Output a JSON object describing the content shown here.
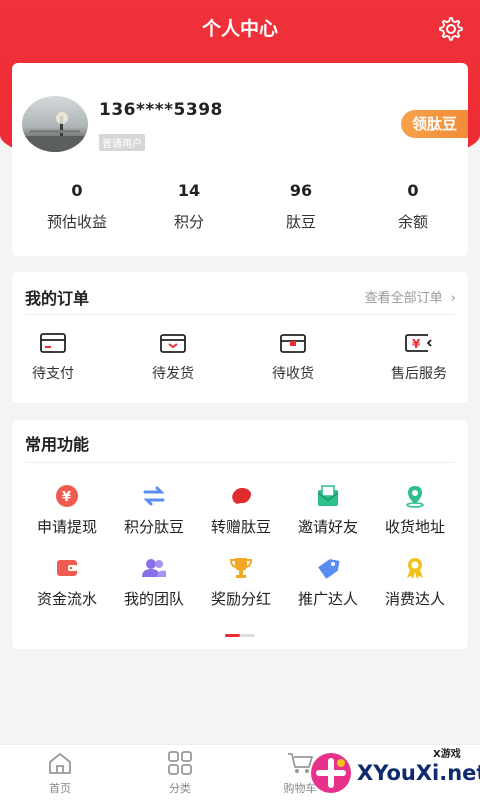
{
  "header": {
    "title": "个人中心"
  },
  "profile": {
    "phone": "136****5398",
    "level": "普通用户",
    "bean_button": "领肽豆",
    "stats": [
      {
        "value": "0",
        "label": "预估收益"
      },
      {
        "value": "14",
        "label": "积分"
      },
      {
        "value": "96",
        "label": "肽豆"
      },
      {
        "value": "0",
        "label": "余额"
      }
    ]
  },
  "orders": {
    "title": "我的订单",
    "view_all": "查看全部订单",
    "items": [
      {
        "label": "待支付",
        "icon": "wallet-icon"
      },
      {
        "label": "待发货",
        "icon": "box-icon"
      },
      {
        "label": "待收货",
        "icon": "package-icon"
      },
      {
        "label": "售后服务",
        "icon": "yen-refund-icon"
      }
    ]
  },
  "functions": {
    "title": "常用功能",
    "items": [
      {
        "label": "申请提现",
        "icon": "yen-coin-icon"
      },
      {
        "label": "积分肽豆",
        "icon": "exchange-icon"
      },
      {
        "label": "转赠肽豆",
        "icon": "bean-icon"
      },
      {
        "label": "邀请好友",
        "icon": "mail-icon"
      },
      {
        "label": "收货地址",
        "icon": "location-icon"
      },
      {
        "label": "资金流水",
        "icon": "wallet-icon"
      },
      {
        "label": "我的团队",
        "icon": "team-icon"
      },
      {
        "label": "奖励分红",
        "icon": "trophy-icon"
      },
      {
        "label": "推广达人",
        "icon": "tag-icon"
      },
      {
        "label": "消费达人",
        "icon": "medal-icon"
      }
    ]
  },
  "tabbar": {
    "items": [
      {
        "label": "首页",
        "icon": "home-icon"
      },
      {
        "label": "分类",
        "icon": "grid-icon"
      },
      {
        "label": "购物车",
        "icon": "cart-icon"
      }
    ]
  },
  "watermark": {
    "text": "XYouXi.net",
    "small": "X游戏"
  },
  "colors": {
    "brand_red": "#ee2a33",
    "orange": "#f28c38"
  }
}
